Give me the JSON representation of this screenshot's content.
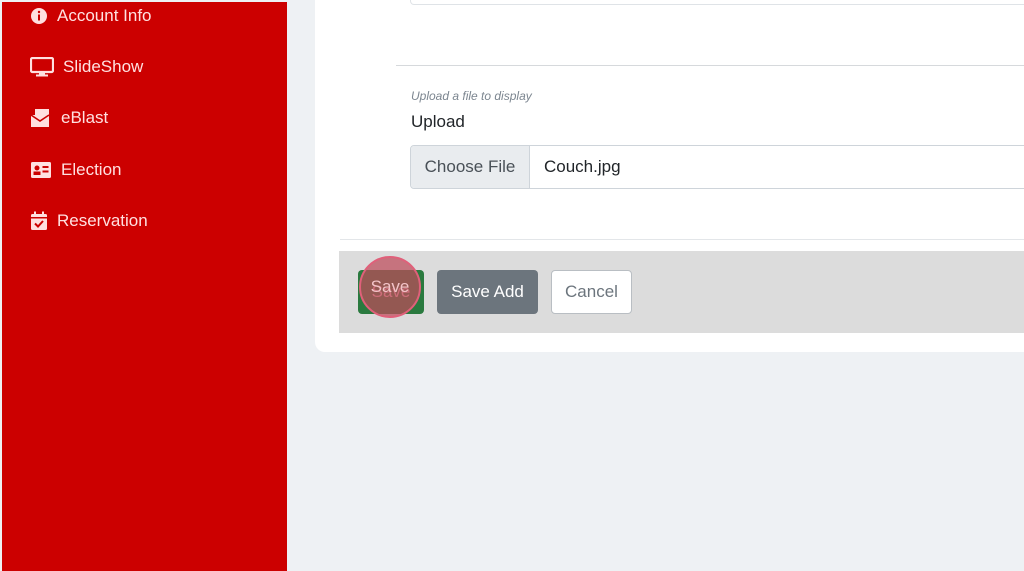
{
  "sidebar": {
    "items": [
      {
        "label": "Account Info",
        "icon": "info-circle-icon"
      },
      {
        "label": "SlideShow",
        "icon": "monitor-icon"
      },
      {
        "label": "eBlast",
        "icon": "mail-icon"
      },
      {
        "label": "Election",
        "icon": "id-card-icon"
      },
      {
        "label": "Reservation",
        "icon": "calendar-check-icon"
      }
    ],
    "background": "#cc0000"
  },
  "upload": {
    "hint": "Upload a file to display",
    "label": "Upload",
    "choose_label": "Choose File",
    "file_name": "Couch.jpg"
  },
  "actions": {
    "save_label": "Save",
    "save_add_label": "Save Add",
    "cancel_label": "Cancel"
  },
  "colors": {
    "sidebar": "#cc0000",
    "save": "#2a7a3f",
    "save_add": "#6c757d",
    "click_marker": "#e0607a"
  }
}
